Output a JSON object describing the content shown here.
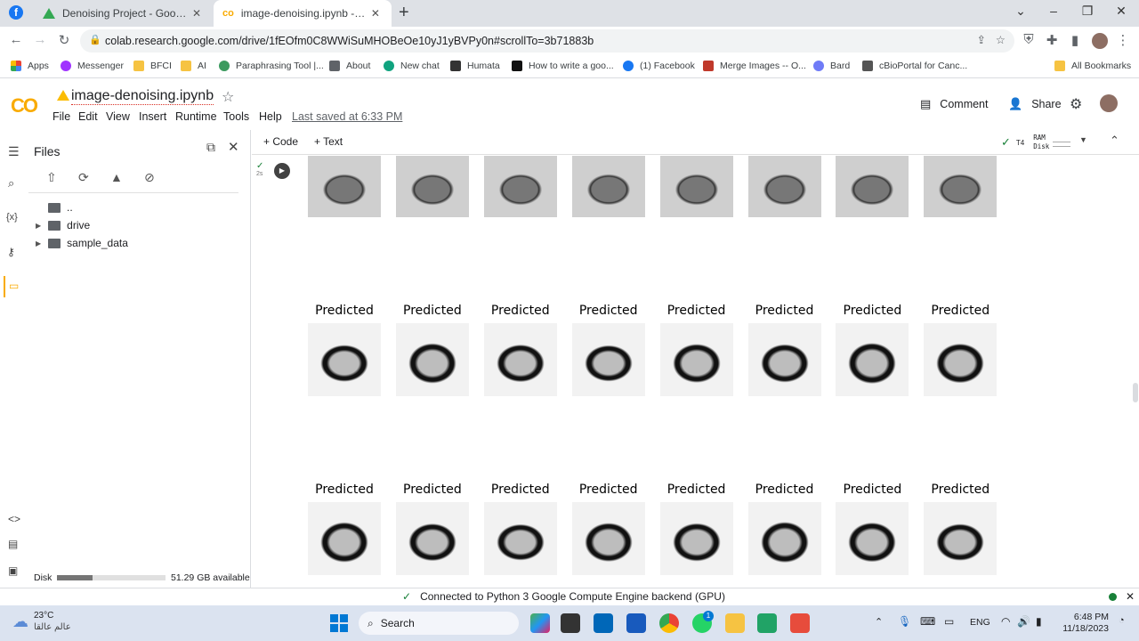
{
  "browser": {
    "tabs": [
      {
        "title": "Denoising Project - Google Drive",
        "active": false
      },
      {
        "title": "image-denoising.ipynb - Colaboratory",
        "active": true
      }
    ],
    "url": "colab.research.google.com/drive/1fEOfm0C8WWiSuMHOBeOe10yJ1yBVPy0n#scrollTo=3b71883b",
    "bookmarks": [
      "Apps",
      "Messenger",
      "BFCI",
      "AI",
      "Paraphrasing Tool |...",
      "About",
      "New chat",
      "Humata",
      "How to write a goo...",
      "(1) Facebook",
      "Merge Images -- O...",
      "Bard",
      "cBioPortal for Canc..."
    ],
    "all_bookmarks": "All Bookmarks"
  },
  "colab": {
    "logo": "CO",
    "notebook_title": "image-denoising.ipynb",
    "menu": [
      "File",
      "Edit",
      "View",
      "Insert",
      "Runtime",
      "Tools",
      "Help"
    ],
    "last_saved": "Last saved at 6:33 PM",
    "comment": "Comment",
    "share": "Share",
    "add_code": "+ Code",
    "add_text": "+ Text",
    "runtime_type": "T4",
    "ram_label": "RAM",
    "disk_label": "Disk",
    "cell_exec": "2s"
  },
  "files": {
    "title": "Files",
    "items": [
      {
        "name": "..",
        "expandable": false
      },
      {
        "name": "drive",
        "expandable": true
      },
      {
        "name": "sample_data",
        "expandable": true
      }
    ],
    "disk_label": "Disk",
    "disk_available": "51.29 GB available",
    "disk_used_fraction": 0.33
  },
  "output": {
    "row_label": "Predicted",
    "rows": 2,
    "cols": 8
  },
  "status": {
    "connection": "Connected to Python 3 Google Compute Engine backend (GPU)"
  },
  "taskbar": {
    "temperature": "23°C",
    "weather_text": "عالم عالقا",
    "search": "Search",
    "language": "ENG",
    "time": "6:48 PM",
    "date": "11/18/2023",
    "whatsapp_badge": "1"
  }
}
